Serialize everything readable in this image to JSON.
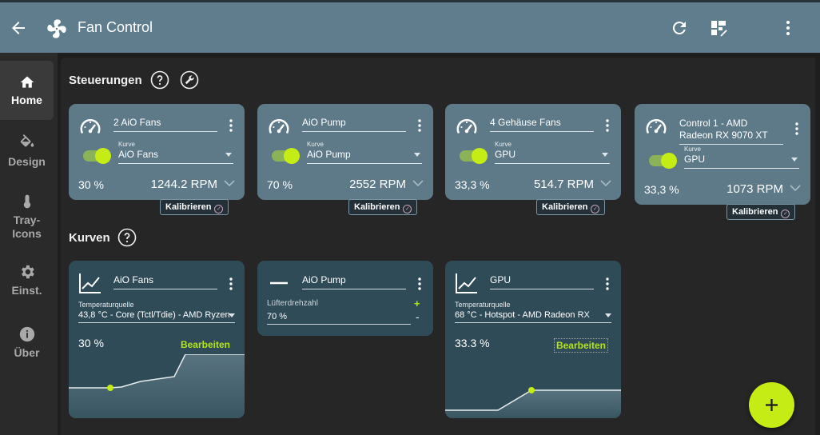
{
  "app": {
    "title": "Fan Control"
  },
  "topbar": {
    "back_icon": "arrow-left-icon",
    "app_icon": "fan-icon",
    "actions": [
      "refresh-icon",
      "dashboard-edit-icon",
      "more-vert-icon"
    ]
  },
  "sidebar": {
    "items": [
      {
        "label": "Home",
        "icon": "home-icon",
        "active": true
      },
      {
        "label": "Design",
        "icon": "paint-bucket-icon",
        "active": false
      },
      {
        "label": "Tray-",
        "label2": "Icons",
        "icon": "thermometer-icon",
        "active": false
      },
      {
        "label": "Einst.",
        "icon": "gear-icon",
        "active": false
      },
      {
        "label": "Über",
        "icon": "info-icon",
        "active": false
      }
    ]
  },
  "controls": {
    "title": "Steuerungen",
    "select_label": "Kurve",
    "calibrate_label": "Kalibrieren",
    "cards": [
      {
        "name": "2 AiO Fans",
        "curve": "AiO Fans",
        "percent": "30 %",
        "rpm": "1244.2 RPM",
        "enabled": true
      },
      {
        "name": "AiO Pump",
        "curve": "AiO Pump",
        "percent": "70 %",
        "rpm": "2552 RPM",
        "enabled": true
      },
      {
        "name": "4 Gehäuse Fans",
        "curve": "GPU",
        "percent": "33,3 %",
        "rpm": "514.7 RPM",
        "enabled": true
      },
      {
        "name": "Control 1 - AMD Radeon RX 9070 XT",
        "curve": "GPU",
        "percent": "33,3 %",
        "rpm": "1073 RPM",
        "enabled": true
      }
    ]
  },
  "curves": {
    "title": "Kurven",
    "source_label": "Temperaturquelle",
    "edit_label": "Bearbeiten",
    "cards": [
      {
        "name": "AiO Fans",
        "source": "43,8 °C - Core (Tctl/Tdie) - AMD Ryzen",
        "percent": "30 %",
        "icon": "graph-icon"
      },
      {
        "name": "AiO Pump",
        "mixed_label": "Lüfterdrehzahl",
        "mixed_value": "70 %",
        "plus": "+",
        "minus": "-",
        "icon": "minus-icon"
      },
      {
        "name": "GPU",
        "source": "68 °C - Hotspot - AMD Radeon RX",
        "percent": "33.3 %",
        "icon": "graph-icon"
      }
    ]
  },
  "colors": {
    "accent": "#c6ec16",
    "topbar": "#5f7d8c",
    "control_card": "#5e7a89",
    "curve_card": "#2f4b58"
  }
}
